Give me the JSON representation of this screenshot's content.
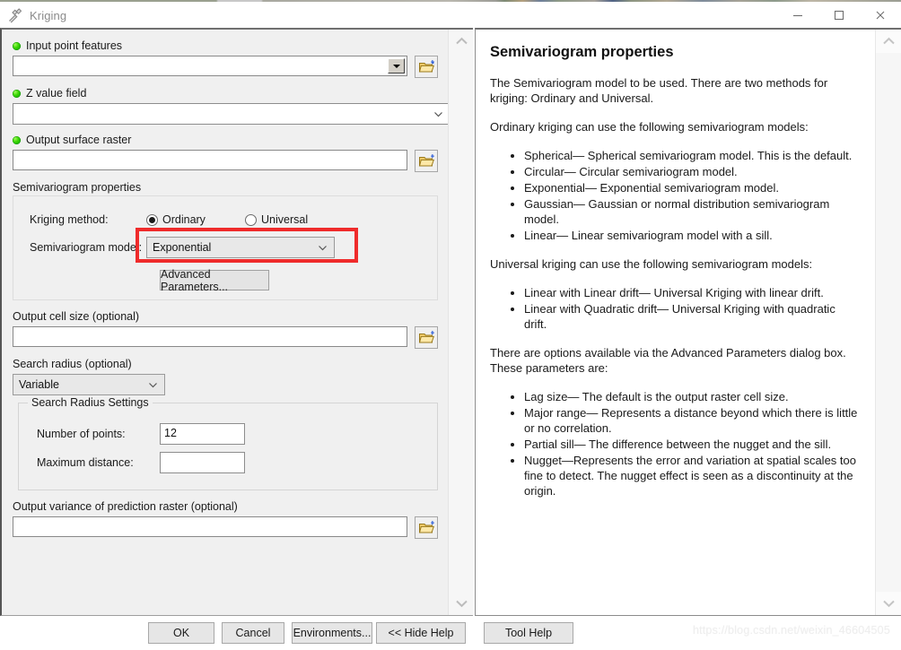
{
  "window": {
    "title": "Kriging",
    "icon": "hammer-icon",
    "minimize_label": "—",
    "maximize_label": "☐",
    "close_label": "×"
  },
  "form": {
    "input_point_features": {
      "label": "Input point features",
      "value": "",
      "required": true
    },
    "z_value_field": {
      "label": "Z value field",
      "value": "",
      "required": true
    },
    "output_surface_raster": {
      "label": "Output surface raster",
      "value": "",
      "required": true
    },
    "semivariogram_properties": {
      "caption": "Semivariogram properties",
      "kriging_method_label": "Kriging method:",
      "options": [
        {
          "label": "Ordinary",
          "selected": true
        },
        {
          "label": "Universal",
          "selected": false
        }
      ],
      "semivariogram_model_label": "Semivariogram model:",
      "semivariogram_model_value": "Exponential",
      "advanced_parameters_button": "Advanced Parameters...",
      "highlight_color": "#ef2b2b"
    },
    "output_cell_size": {
      "label": "Output cell size (optional)",
      "value": ""
    },
    "search_radius": {
      "label": "Search radius (optional)",
      "value": "Variable"
    },
    "search_radius_settings": {
      "legend": "Search Radius Settings",
      "number_of_points_label": "Number of points:",
      "number_of_points_value": "12",
      "maximum_distance_label": "Maximum distance:",
      "maximum_distance_value": ""
    },
    "output_variance_raster": {
      "label": "Output variance of prediction raster (optional)",
      "value": ""
    }
  },
  "help": {
    "title": "Semivariogram properties",
    "paragraph_1": "The Semivariogram model to be used. There are two methods for kriging: Ordinary and Universal.",
    "paragraph_2": "Ordinary kriging can use the following semivariogram models:",
    "list_1": [
      "Spherical— Spherical semivariogram model. This is the default.",
      "Circular— Circular semivariogram model.",
      "Exponential— Exponential semivariogram model.",
      "Gaussian— Gaussian or normal distribution semivariogram model.",
      "Linear— Linear semivariogram model with a sill."
    ],
    "paragraph_3": "Universal kriging can use the following semivariogram models:",
    "list_2": [
      "Linear with Linear drift— Universal Kriging with linear drift.",
      "Linear with Quadratic drift— Universal Kriging with quadratic drift."
    ],
    "paragraph_4": "There are options available via the Advanced Parameters dialog box. These parameters are:",
    "list_3": [
      "Lag size— The default is the output raster cell size.",
      "Major range— Represents a distance beyond which there is little or no correlation.",
      "Partial sill— The difference between the nugget and the sill.",
      "Nugget—Represents the error and variation at spatial scales too fine to detect. The nugget effect is seen as a discontinuity at the origin."
    ]
  },
  "footer": {
    "ok": "OK",
    "cancel": "Cancel",
    "environments": "Environments...",
    "hide_help": "<< Hide Help",
    "tool_help": "Tool Help",
    "watermark": "https://blog.csdn.net/weixin_46604505"
  }
}
